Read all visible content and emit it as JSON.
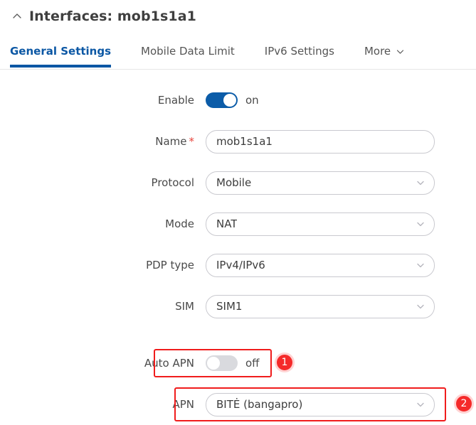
{
  "header": {
    "collapse_icon": "chevron-up-icon",
    "title": "Interfaces: mob1s1a1"
  },
  "tabs": [
    {
      "label": "General Settings",
      "active": true
    },
    {
      "label": "Mobile Data Limit",
      "active": false
    },
    {
      "label": "IPv6 Settings",
      "active": false
    },
    {
      "label": "More",
      "active": false,
      "icon": "chevron-down-icon"
    }
  ],
  "form": {
    "enable": {
      "label": "Enable",
      "state_text": "on",
      "checked": true
    },
    "name": {
      "label": "Name",
      "required_marker": "*",
      "value": "mob1s1a1",
      "placeholder": ""
    },
    "protocol": {
      "label": "Protocol",
      "value": "Mobile",
      "icon": "chevron-down-icon"
    },
    "mode": {
      "label": "Mode",
      "value": "NAT",
      "icon": "chevron-down-icon"
    },
    "pdp_type": {
      "label": "PDP type",
      "value": "IPv4/IPv6",
      "icon": "chevron-down-icon"
    },
    "sim": {
      "label": "SIM",
      "value": "SIM1",
      "icon": "chevron-down-icon"
    },
    "auto_apn": {
      "label": "Auto APN",
      "state_text": "off",
      "checked": false
    },
    "apn": {
      "label": "APN",
      "value": "BITĖ (bangapro)",
      "icon": "chevron-down-icon"
    }
  },
  "annotations": [
    {
      "number": "1",
      "target": "Auto APN"
    },
    {
      "number": "2",
      "target": "APN"
    }
  ],
  "colors": {
    "accent_blue": "#0b57a4",
    "toggle_on": "#0b5ca8",
    "toggle_off": "#d9dade",
    "highlight_red": "#f01c1c",
    "badge_red": "#f52a2a",
    "required_red": "#e8453c",
    "field_border": "#c9c9cf"
  }
}
